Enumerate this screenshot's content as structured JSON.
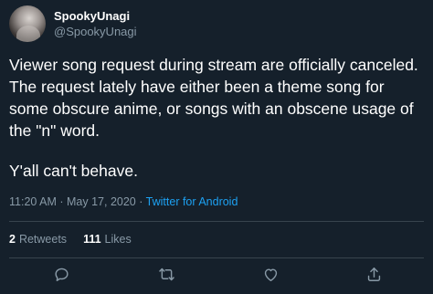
{
  "user": {
    "display_name": "SpookyUnagi",
    "handle": "@SpookyUnagi"
  },
  "tweet": {
    "paragraph_1": "Viewer song request during stream are officially canceled. The request lately have either been a theme song for some obscure anime, or songs with an obscene usage of the \"n\" word.",
    "paragraph_2": "Y'all can't behave.",
    "time": "11:20 AM",
    "date": "May 17, 2020",
    "separator": "·",
    "source": "Twitter for Android"
  },
  "stats": {
    "retweets_count": "2",
    "retweets_label": "Retweets",
    "likes_count": "111",
    "likes_label": "Likes"
  },
  "actions": {
    "reply_icon": "reply-icon",
    "retweet_icon": "retweet-icon",
    "like_icon": "heart-icon",
    "share_icon": "share-icon"
  },
  "colors": {
    "background": "#15202b",
    "text": "#ffffff",
    "secondary": "#8899a6",
    "link": "#1da1f2",
    "divider": "#38444d"
  }
}
